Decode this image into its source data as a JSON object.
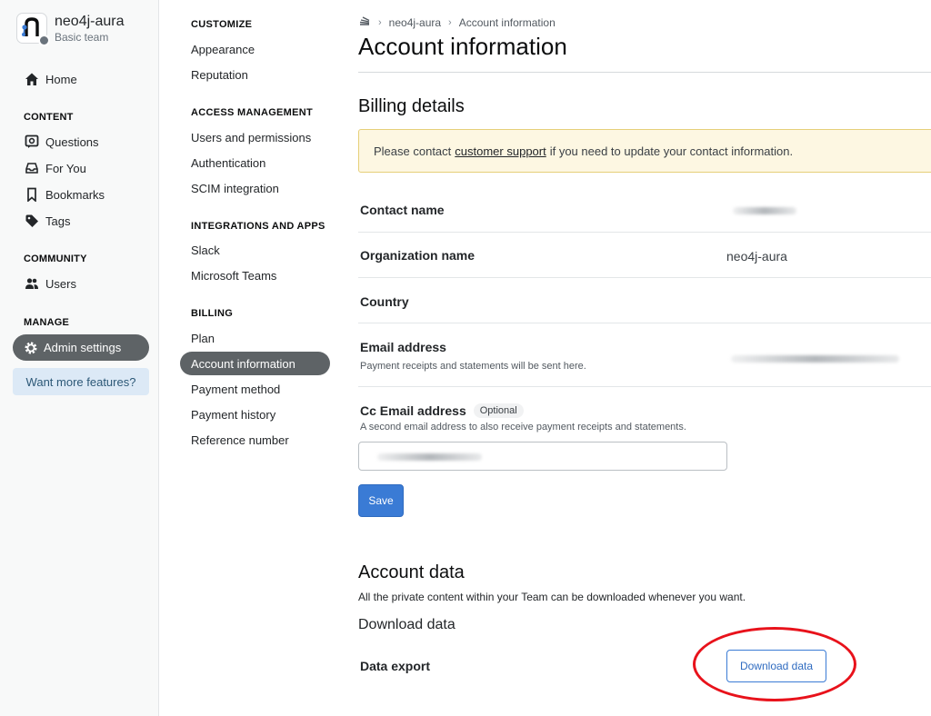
{
  "team": {
    "name": "neo4j-aura",
    "subtitle": "Basic team"
  },
  "sidebar": {
    "home": "Home",
    "content_heading": "CONTENT",
    "content_items": [
      "Questions",
      "For You",
      "Bookmarks",
      "Tags"
    ],
    "community_heading": "COMMUNITY",
    "community_items": [
      "Users"
    ],
    "manage_heading": "MANAGE",
    "admin_settings": "Admin settings",
    "more_features": "Want more features?"
  },
  "settings_menu": {
    "customize_heading": "CUSTOMIZE",
    "customize": [
      "Appearance",
      "Reputation"
    ],
    "access_heading": "ACCESS MANAGEMENT",
    "access": [
      "Users and permissions",
      "Authentication",
      "SCIM integration"
    ],
    "integrations_heading": "INTEGRATIONS AND APPS",
    "integrations": [
      "Slack",
      "Microsoft Teams"
    ],
    "billing_heading": "BILLING",
    "billing": [
      "Plan",
      "Account information",
      "Payment method",
      "Payment history",
      "Reference number"
    ]
  },
  "breadcrumb": {
    "team": "neo4j-aura",
    "current": "Account information"
  },
  "page_title": "Account information",
  "billing": {
    "title": "Billing details",
    "notice_before": "Please contact",
    "notice_link": "customer support",
    "notice_after": "if you need to update your contact information.",
    "contact_name_label": "Contact name",
    "org_name_label": "Organization name",
    "org_name_value": "neo4j-aura",
    "country_label": "Country",
    "email_label": "Email address",
    "email_desc": "Payment receipts and statements will be sent here.",
    "cc_label": "Cc Email address",
    "cc_optional": "Optional",
    "cc_desc": "A second email address to also receive payment receipts and statements.",
    "save": "Save"
  },
  "account_data": {
    "title": "Account data",
    "desc": "All the private content within your Team can be downloaded whenever you want.",
    "download_title": "Download data",
    "export_label": "Data export",
    "download_button": "Download data"
  },
  "colors": {
    "accent": "#3a7bd5",
    "active_pill": "#5e6366",
    "highlight_ring": "#e8121b",
    "notice_bg": "#fdf7e2"
  }
}
